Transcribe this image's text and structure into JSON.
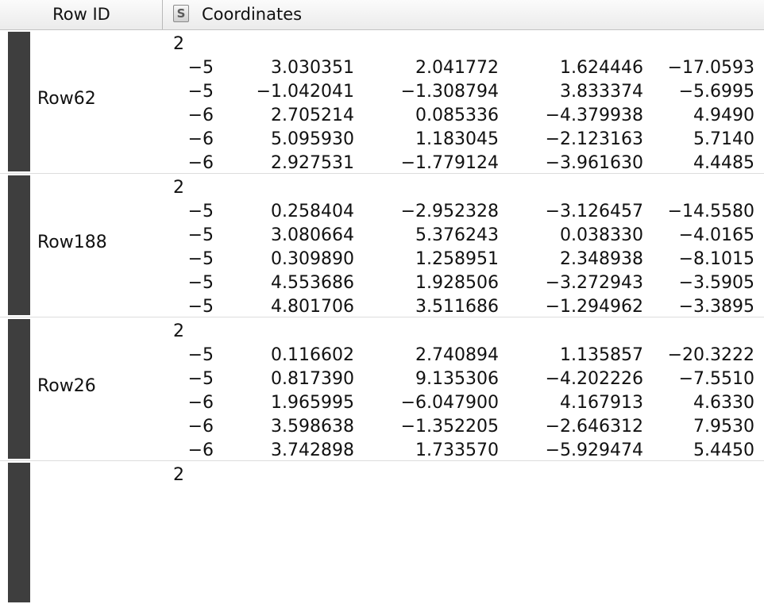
{
  "header": {
    "row_id_label": "Row ID",
    "type_icon_glyph": "S",
    "coordinates_label": "Coordinates"
  },
  "rows": [
    {
      "label": "Row62",
      "dim": "2",
      "matrix": [
        [
          "−5",
          "3.030351",
          "2.041772",
          "1.624446",
          "−17.0593"
        ],
        [
          "−5",
          "−1.042041",
          "−1.308794",
          "3.833374",
          "−5.6995"
        ],
        [
          "−6",
          "2.705214",
          "0.085336",
          "−4.379938",
          "4.9490"
        ],
        [
          "−6",
          "5.095930",
          "1.183045",
          "−2.123163",
          "5.7140"
        ],
        [
          "−6",
          "2.927531",
          "−1.779124",
          "−3.961630",
          "4.4485"
        ]
      ]
    },
    {
      "label": "Row188",
      "dim": "2",
      "matrix": [
        [
          "−5",
          "0.258404",
          "−2.952328",
          "−3.126457",
          "−14.5580"
        ],
        [
          "−5",
          "3.080664",
          "5.376243",
          "0.038330",
          "−4.0165"
        ],
        [
          "−5",
          "0.309890",
          "1.258951",
          "2.348938",
          "−8.1015"
        ],
        [
          "−5",
          "4.553686",
          "1.928506",
          "−3.272943",
          "−3.5905"
        ],
        [
          "−5",
          "4.801706",
          "3.511686",
          "−1.294962",
          "−3.3895"
        ]
      ]
    },
    {
      "label": "Row26",
      "dim": "2",
      "matrix": [
        [
          "−5",
          "0.116602",
          "2.740894",
          "1.135857",
          "−20.3222"
        ],
        [
          "−5",
          "0.817390",
          "9.135306",
          "−4.202226",
          "−7.5510"
        ],
        [
          "−6",
          "1.965995",
          "−6.047900",
          "4.167913",
          "4.6330"
        ],
        [
          "−6",
          "3.598638",
          "−1.352205",
          "−2.646312",
          "7.9530"
        ],
        [
          "−6",
          "3.742898",
          "1.733570",
          "−5.929474",
          "5.4450"
        ]
      ]
    },
    {
      "label": "",
      "dim": "2",
      "matrix": []
    }
  ]
}
